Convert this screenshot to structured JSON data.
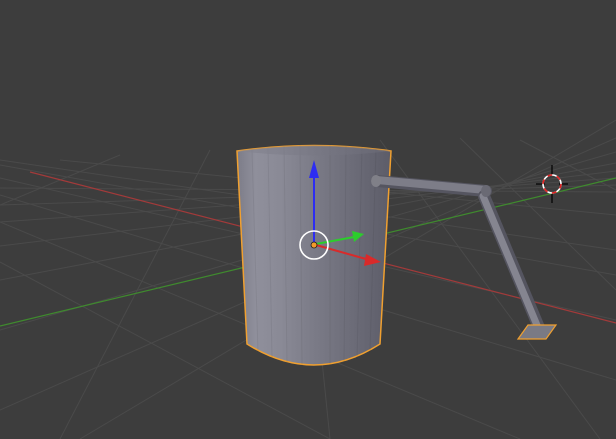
{
  "app": "3D viewport",
  "colors": {
    "background": "#3d3d3d",
    "grid": "#4a4a4a",
    "x_axis": "#a23a3a",
    "y_axis": "#3f8a2e",
    "selection_outline": "#f0a030",
    "gizmo_z": "#2d2df2",
    "gizmo_y": "#2ccd2c",
    "gizmo_x": "#d92a2a",
    "origin_dot": "#f29a2a"
  },
  "objects": [
    {
      "name": "cylinder",
      "state": "selected"
    },
    {
      "name": "bent-pipe",
      "state": "unselected"
    },
    {
      "name": "plane-foot",
      "state": "selected"
    }
  ],
  "icons": {
    "cursor": "3d-cursor-icon",
    "gizmo": "transform-gizmo-icon",
    "origin": "object-origin-icon"
  }
}
